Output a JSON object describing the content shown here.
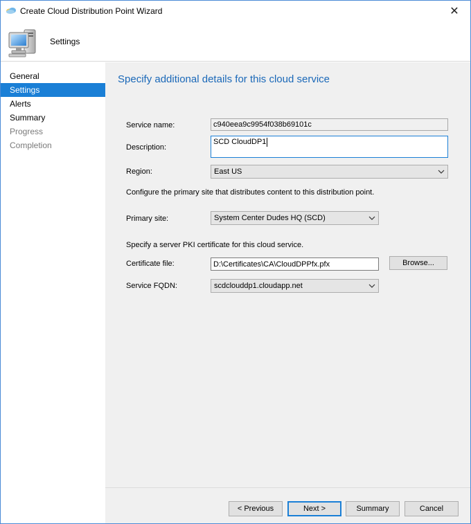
{
  "window": {
    "title": "Create Cloud Distribution Point Wizard",
    "close_glyph": "✕"
  },
  "header": {
    "title": "Settings",
    "icon": "computer-icon"
  },
  "nav": {
    "items": [
      {
        "label": "General",
        "state": "normal"
      },
      {
        "label": "Settings",
        "state": "active"
      },
      {
        "label": "Alerts",
        "state": "normal"
      },
      {
        "label": "Summary",
        "state": "normal"
      },
      {
        "label": "Progress",
        "state": "disabled"
      },
      {
        "label": "Completion",
        "state": "disabled"
      }
    ]
  },
  "main": {
    "heading": "Specify additional details for this cloud service",
    "service_name": {
      "label": "Service name:",
      "value": "c940eea9c9954f038b69101c"
    },
    "description": {
      "label": "Description:",
      "value": "SCD CloudDP1"
    },
    "region": {
      "label": "Region:",
      "value": "East US"
    },
    "primary_site_info": "Configure the primary site that distributes content to this distribution point.",
    "primary_site": {
      "label": "Primary site:",
      "value": "System Center Dudes HQ (SCD)"
    },
    "certificate_info": "Specify a server PKI certificate for this cloud service.",
    "certificate_file": {
      "label": "Certificate file:",
      "value": "D:\\Certificates\\CA\\CloudDPPfx.pfx"
    },
    "browse_label": "Browse...",
    "service_fqdn": {
      "label": "Service FQDN:",
      "value": "scdclouddp1.cloudapp.net"
    }
  },
  "footer": {
    "previous_label": "< Previous",
    "next_label": "Next >",
    "summary_label": "Summary",
    "cancel_label": "Cancel"
  },
  "colors": {
    "accent": "#1a7fd6",
    "heading": "#1a68b8",
    "panel_bg": "#f0f0f0"
  }
}
